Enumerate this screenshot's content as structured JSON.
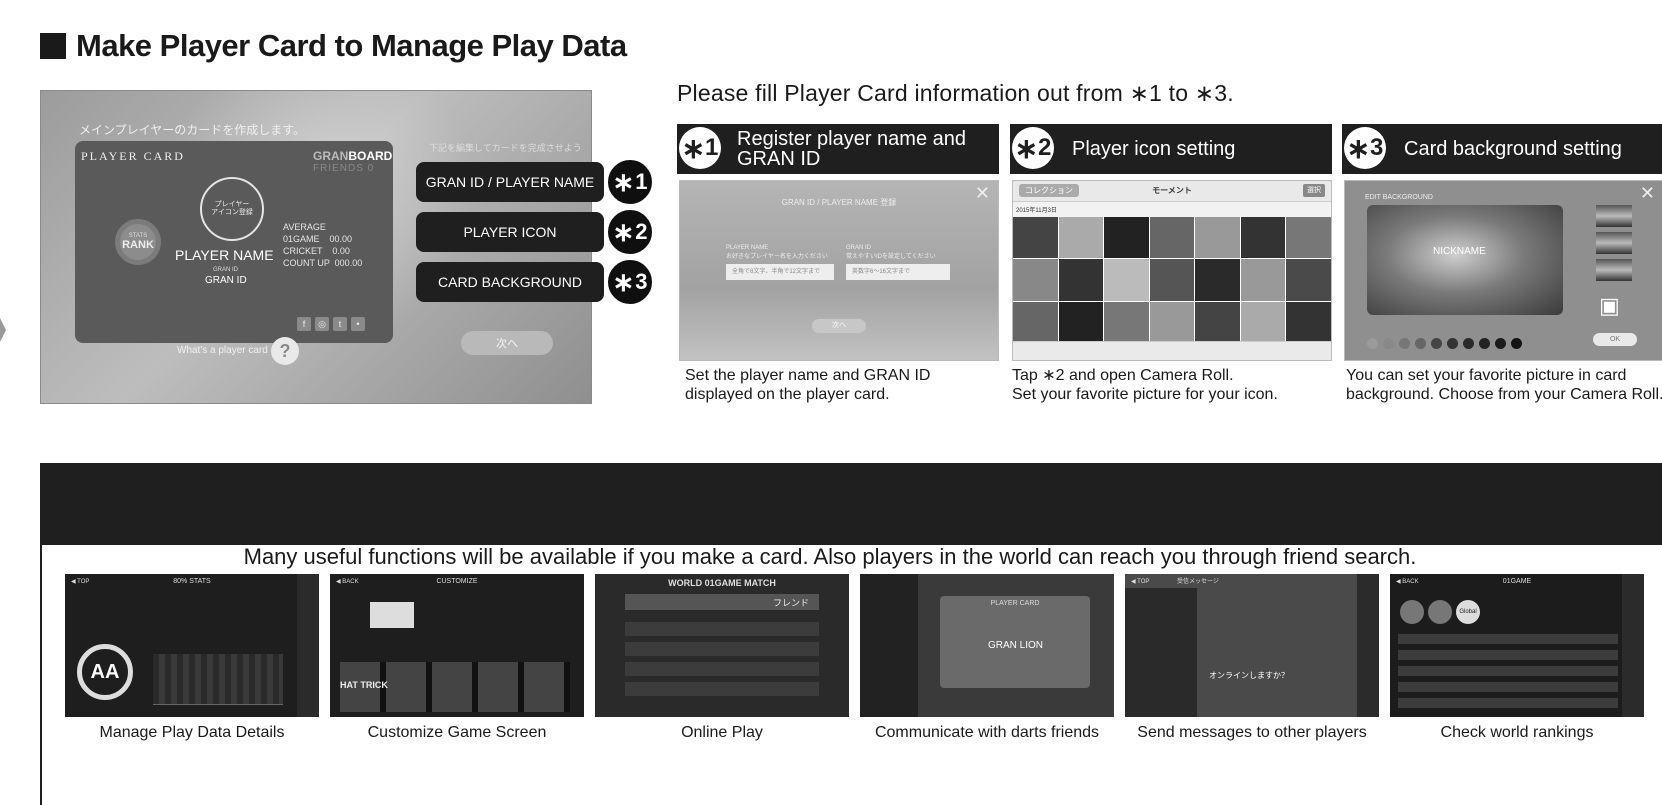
{
  "heading": "Make Player Card to Manage Play Data",
  "player_card_screen": {
    "prompt": "メインプレイヤーのカードを作成します。",
    "right_prompt": "下記を編集してカードを完成させよう",
    "card_label": "PLAYER CARD",
    "brand_gran": "GRAN",
    "brand_board": "BOARD",
    "friends": "FRIENDS 0",
    "icon_circle": "プレイヤー\nアイコン登録",
    "stats_label": "STATS",
    "rank_label": "RANK",
    "player_name": "PLAYER NAME",
    "gran_id_label": "GRAN ID",
    "gran_id": "GRAN ID",
    "average_title": "AVERAGE",
    "average_rows": [
      "01GAME    00.00",
      "CRICKET    0.00",
      "COUNT UP  000.00"
    ],
    "next_button": "次へ",
    "whats_card": "What's a player card",
    "question": "?"
  },
  "pills": [
    {
      "label": "GRAN ID / PLAYER NAME",
      "badge": "1"
    },
    {
      "label": "PLAYER ICON",
      "badge": "2"
    },
    {
      "label": "CARD BACKGROUND",
      "badge": "3"
    }
  ],
  "star_glyph": "∗",
  "instruction": "Please fill Player Card information out from ∗1 to ∗3.",
  "steps": [
    {
      "num": "1",
      "title": "Register player name and GRAN ID",
      "caption": [
        "Set the player name and GRAN ID",
        "displayed on the player card."
      ]
    },
    {
      "num": "2",
      "title": "Player icon setting",
      "caption": [
        "Tap ∗2 and open Camera Roll.",
        "Set your favorite picture for your icon."
      ]
    },
    {
      "num": "3",
      "title": "Card background setting",
      "caption": [
        "You can set your favorite picture in card",
        "background. Choose from your Camera Roll."
      ]
    }
  ],
  "step1_screen": {
    "header": "GRAN ID / PLAYER NAME 登録",
    "label_name": "PLAYER NAME\nお好きなプレイヤー名を入力ください",
    "label_id": "GRAN ID\n覚えやすいIDを設定してください",
    "input_name": "全角で8文字、半角で12文字まで",
    "input_id": "英数字6〜16文字まで",
    "next": "次へ",
    "close": "✕"
  },
  "step2_screen": {
    "back": "コレクション",
    "title": "モーメント",
    "select": "選択",
    "date": "2015年11月3日"
  },
  "step3_screen": {
    "header": "EDIT BACKGROUND",
    "nickname": "NICKNAME",
    "ok": "OK",
    "close": "✕"
  },
  "functions_banner": "Many useful functions will be available if you make a card. Also players in the world can reach you through friend search.",
  "features": [
    {
      "caption": "Manage Play Data Details",
      "screen_title": "80% STATS",
      "extra": "AA"
    },
    {
      "caption": "Customize Game Screen",
      "screen_title": "CUSTOMIZE",
      "extra": "HAT TRICK"
    },
    {
      "caption": "Online Play",
      "screen_title": "WORLD 01GAME MATCH",
      "extra": "フレンド"
    },
    {
      "caption": "Communicate with darts friends",
      "screen_title": "PLAYER CARD",
      "extra": "GRAN LION"
    },
    {
      "caption": "Send messages to other players",
      "screen_title": "受信メッセージ",
      "extra": "オンラインしますか？"
    },
    {
      "caption": "Check world rankings",
      "screen_title": "01GAME",
      "extra": "Global"
    }
  ]
}
